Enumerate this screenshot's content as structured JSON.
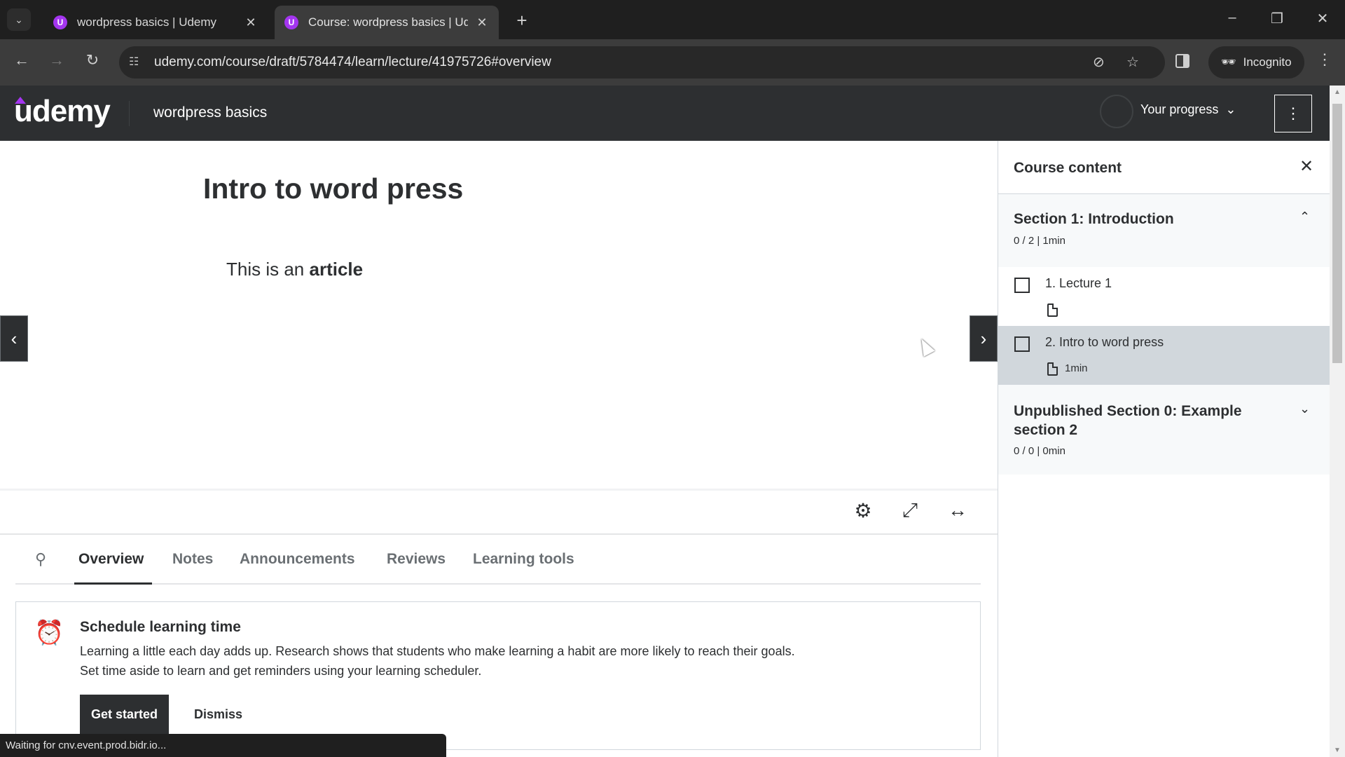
{
  "browser": {
    "tabs": [
      {
        "title": "wordpress basics | Udemy",
        "favicon": "U",
        "active": false
      },
      {
        "title": "Course: wordpress basics | Ude",
        "favicon": "U",
        "active": true
      }
    ],
    "url": "udemy.com/course/draft/5784474/learn/lecture/41975726#overview",
    "incognito_label": "Incognito",
    "status_text": "Waiting for cnv.event.prod.bidr.io..."
  },
  "header": {
    "logo": "udemy",
    "course_title": "wordpress basics",
    "progress_label": "Your progress"
  },
  "lecture": {
    "title": "Intro to word press",
    "body_prefix": "This is an ",
    "body_bold": "article"
  },
  "content_tabs": [
    {
      "label": "Overview",
      "active": true
    },
    {
      "label": "Notes",
      "active": false
    },
    {
      "label": "Announcements",
      "active": false
    },
    {
      "label": "Reviews",
      "active": false
    },
    {
      "label": "Learning tools",
      "active": false
    }
  ],
  "schedule": {
    "title": "Schedule learning time",
    "line1": "Learning a little each day adds up. Research shows that students who make learning a habit are more likely to reach their goals.",
    "line2": "Set time aside to learn and get reminders using your learning scheduler.",
    "primary_label": "Get started",
    "dismiss_label": "Dismiss"
  },
  "sidebar": {
    "title": "Course content",
    "sections": [
      {
        "title": "Section 1: Introduction",
        "meta": "0 / 2 | 1min",
        "expanded": true,
        "lectures": [
          {
            "title": "1. Lecture 1",
            "duration": "",
            "completed": false,
            "current": false
          },
          {
            "title": "2. Intro to word press",
            "duration": "1min",
            "completed": false,
            "current": true
          }
        ]
      },
      {
        "title": "Unpublished Section 0: Example section 2",
        "meta": "0 / 0 | 0min",
        "expanded": false,
        "lectures": []
      }
    ]
  },
  "colors": {
    "brand": "#a435f0",
    "header_bg": "#2d2f31",
    "current_lecture_bg": "#d1d7dc"
  }
}
